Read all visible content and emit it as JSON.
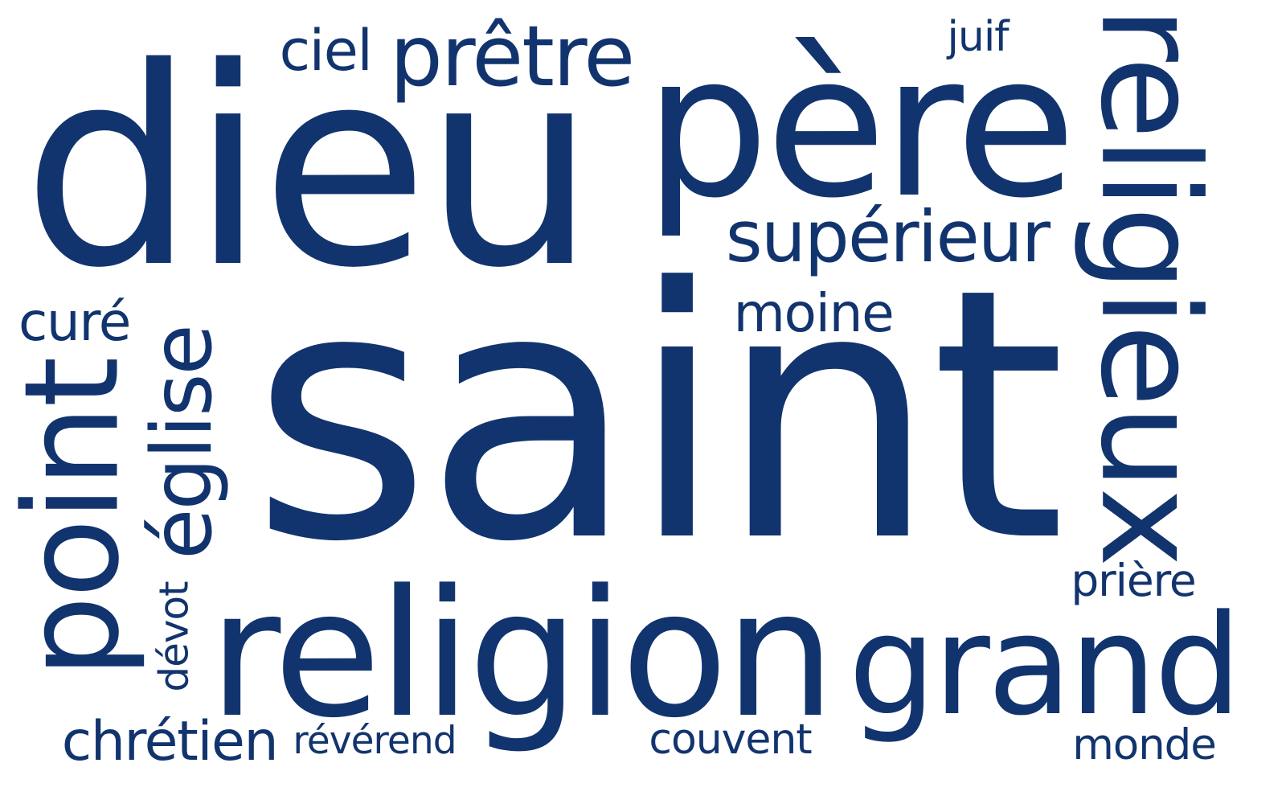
{
  "color": "#12346e",
  "words": {
    "saint": "saint",
    "dieu": "dieu",
    "religion": "religion",
    "pere": "père",
    "religieux": "religieux",
    "point": "point",
    "grand": "grand",
    "pretre": "prêtre",
    "superieur": "supérieur",
    "eglise": "église",
    "ciel": "ciel",
    "moine": "moine",
    "cure": "curé",
    "chretien": "chrétien",
    "reverend": "révérend",
    "couvent": "couvent",
    "monde": "monde",
    "priere": "prière",
    "juif": "juif",
    "devot": "dévot"
  }
}
